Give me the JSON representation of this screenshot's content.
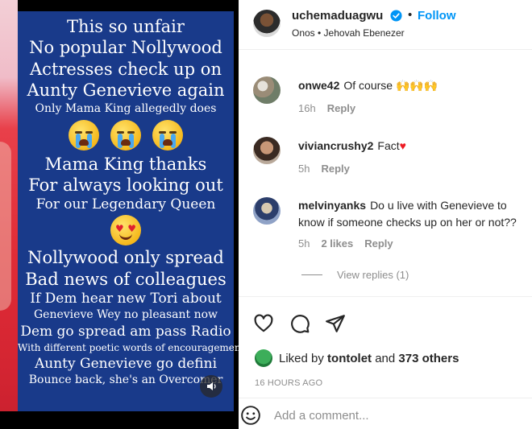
{
  "post_image": {
    "lines": [
      {
        "text": "This so unfair",
        "size": "big"
      },
      {
        "text": "No popular Nollywood",
        "size": "big"
      },
      {
        "text": "Actresses check up on",
        "size": "big"
      },
      {
        "text": "Aunty Genevieve again",
        "size": "big"
      },
      {
        "text": "Only Mama King allegedly does",
        "size": "small"
      }
    ],
    "lines2": [
      {
        "text": "Mama King thanks",
        "size": "big"
      },
      {
        "text": "For always looking out",
        "size": "big"
      },
      {
        "text": "For our Legendary Queen",
        "size": "med"
      }
    ],
    "lines3": [
      {
        "text": "Nollywood only spread",
        "size": "big"
      },
      {
        "text": "Bad news of colleagues",
        "size": "big"
      },
      {
        "text": "If Dem hear new Tori about",
        "size": "med"
      },
      {
        "text": "Genevieve Wey no pleasant now",
        "size": "small"
      },
      {
        "text": "Dem go spread am pass Radio",
        "size": "med"
      },
      {
        "text": "With different poetic words of encouragement",
        "size": "tiny"
      },
      {
        "text": "Aunty Genevieve go defini",
        "size": "med"
      },
      {
        "text": "Bounce back, she's an Overcomer",
        "size": "small"
      }
    ],
    "emoji_row_1": [
      "crying-face",
      "crying-face",
      "crying-face"
    ],
    "emoji_row_2": [
      "heart-eyes-face"
    ]
  },
  "header": {
    "username": "uchemaduagwu",
    "dot": "•",
    "follow_label": "Follow",
    "location": "Onos • Jehovah Ebenezer"
  },
  "comments": [
    {
      "username": "onwe42",
      "text": "Of course 🙌🙌🙌",
      "time": "16h",
      "likes": "",
      "reply": "Reply"
    },
    {
      "username": "viviancrushy2",
      "text": "Fact",
      "time": "5h",
      "likes": "",
      "reply": "Reply"
    },
    {
      "username": "melvinyanks",
      "text": "Do u live with Genevieve to know if someone checks up on her or not??",
      "time": "5h",
      "likes": "2 likes",
      "reply": "Reply"
    }
  ],
  "view_replies_label": "View replies (1)",
  "likes": {
    "prefix": "Liked by",
    "user": "tontolet",
    "connector": "and",
    "others": "373 others"
  },
  "timestamp": "16 HOURS AGO",
  "add_comment": {
    "placeholder": "Add a comment..."
  },
  "colors": {
    "card_blue": "#193a8a",
    "follow_blue": "#0095f6",
    "muted_gray": "#8e8e8e",
    "heart_red": "#ed1c24"
  },
  "icons": [
    "verified-badge-icon",
    "heart-icon",
    "comment-icon",
    "share-icon",
    "smile-icon",
    "audio-icon"
  ]
}
